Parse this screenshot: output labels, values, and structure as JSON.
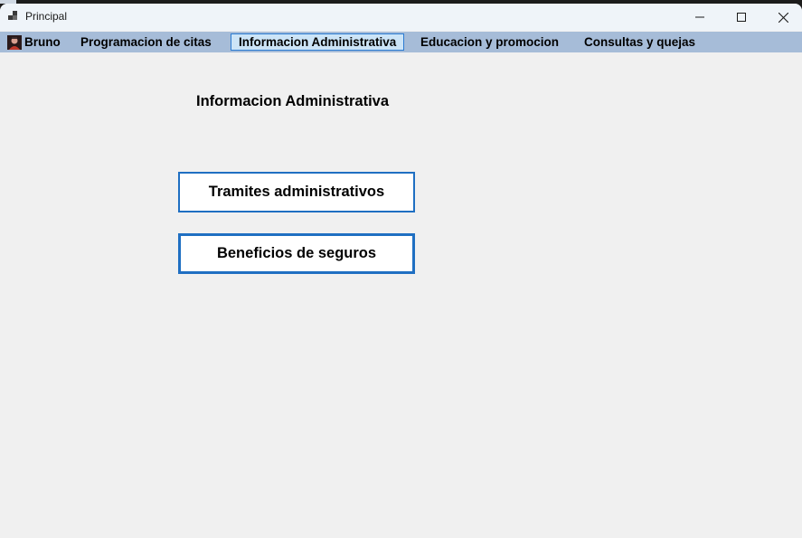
{
  "window": {
    "title": "Principal",
    "controls": [
      "minimize-icon",
      "maximize-icon",
      "close-icon"
    ]
  },
  "menu": {
    "items": [
      {
        "label": "Bruno",
        "icon": "user-avatar-icon"
      },
      {
        "label": "Programacion de citas"
      },
      {
        "label": "Informacion Administrativa",
        "selected": true
      },
      {
        "label": "Educacion y promocion"
      },
      {
        "label": "Consultas y quejas"
      }
    ]
  },
  "main": {
    "section_title": "Informacion Administrativa",
    "buttons": [
      {
        "label": "Tramites administrativos"
      },
      {
        "label": "Beneficios de seguros",
        "focused": true
      }
    ]
  },
  "colors": {
    "menubar": "#a6bcd8",
    "selected_menu_bg": "#cce4f7",
    "selected_menu_border": "#2b7bd2",
    "button_border": "#1f6fc2",
    "background": "#f0f0f0"
  }
}
